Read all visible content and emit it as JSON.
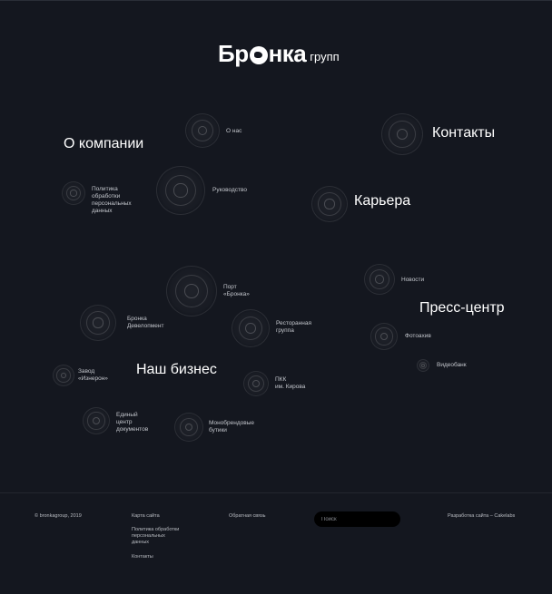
{
  "logo": {
    "main_left": "Бр",
    "main_right": "нка",
    "sub": "групп"
  },
  "sections": {
    "about": "О компании",
    "contacts": "Контакты",
    "career": "Карьера",
    "press": "Пресс-центр",
    "business": "Наш бизнес"
  },
  "links": {
    "about_us": "О нас",
    "policy": "Политика\nобработки\nперсональных\nданных",
    "management": "Руководство",
    "port": "Порт\n«Бронка»",
    "news": "Новости",
    "bronka_dev": "Бронка\nДевелопмент",
    "restaurant": "Ресторанная\nгруппа",
    "photo": "Фотоахив",
    "plant": "Завод\n«Изнерон»",
    "videobank": "Видеобанк",
    "pkk": "ПКК\nим. Кирова",
    "doc_center": "Единый\nцентр\nдокументов",
    "mono": "Монобрендовые\nбутики"
  },
  "footer": {
    "copyright": "© bronkagroup, 2019",
    "sitemap": "Карта сайта",
    "policy": "Политика обработки\nперсональных\nданных",
    "contacts": "Контакты",
    "feedback": "Обратная связь",
    "search_placeholder": "Поиск",
    "developer": "Разработка сайта – Cakelabs"
  }
}
